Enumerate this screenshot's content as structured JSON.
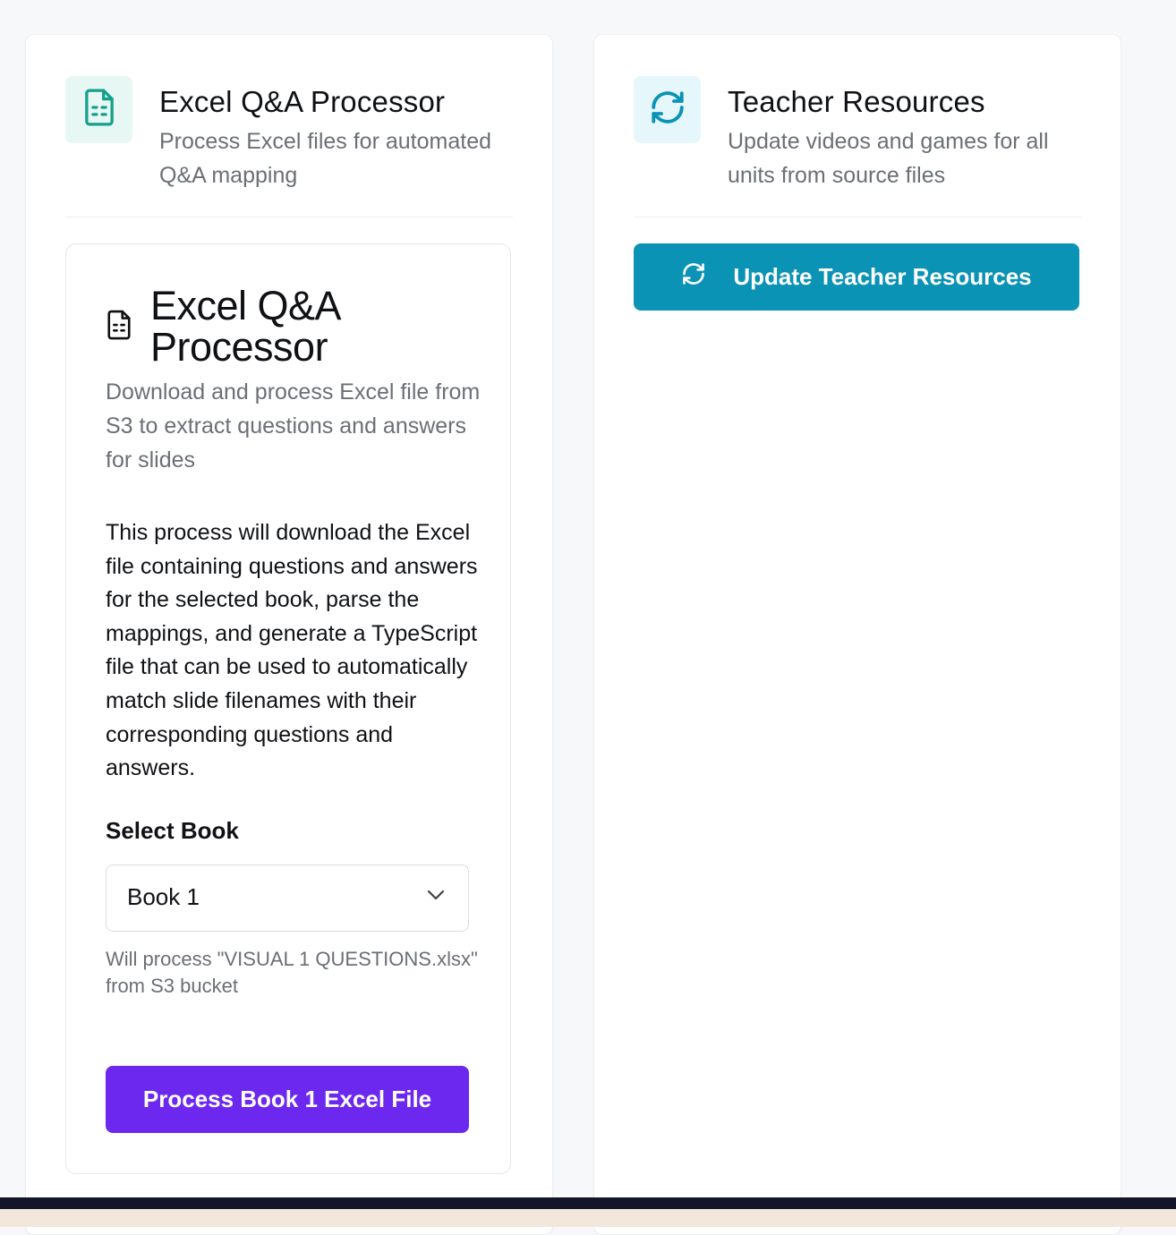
{
  "left_card": {
    "title": "Excel Q&A Processor",
    "subtitle": "Process Excel files for automated Q&A mapping",
    "icon": "file-spreadsheet-icon",
    "accent": "#14a08a",
    "inner": {
      "title": "Excel Q&A Processor",
      "description": "Download and process Excel file from S3 to extract questions and answers for slides",
      "body": "This process will download the Excel file containing questions and answers for the selected book, parse the mappings, and generate a TypeScript file that can be used to automatically match slide filenames with their corresponding questions and answers.",
      "select_label": "Select Book",
      "select_value": "Book 1",
      "hint": "Will process \"VISUAL 1 QUESTIONS.xlsx\" from S3 bucket",
      "button_label": "Process Book 1 Excel File",
      "button_color": "#6d28f0"
    }
  },
  "right_card": {
    "title": "Teacher Resources",
    "subtitle": "Update videos and games for all units from source files",
    "icon": "refresh-icon",
    "accent": "#0b93b6",
    "button_label": "Update Teacher Resources",
    "button_color": "#0b93b6"
  }
}
